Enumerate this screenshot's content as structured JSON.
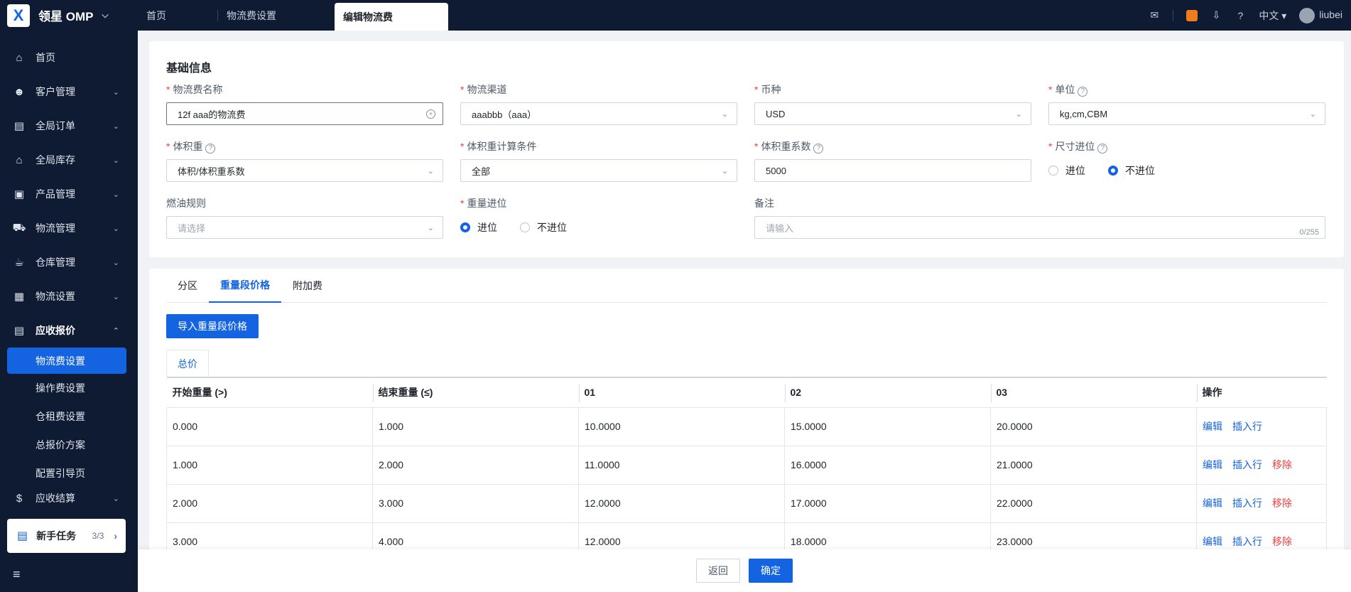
{
  "app": {
    "name": "领星 OMP",
    "logo": "X"
  },
  "tabs": [
    {
      "label": "首页"
    },
    {
      "label": "物流费设置"
    },
    {
      "label": "编辑物流费"
    }
  ],
  "topbar": {
    "lang": "中文",
    "user": "liubei"
  },
  "sidebar": {
    "items": [
      {
        "label": "首页",
        "icon": "home-icon"
      },
      {
        "label": "客户管理",
        "icon": "customer-icon"
      },
      {
        "label": "全局订单",
        "icon": "order-icon"
      },
      {
        "label": "全局库存",
        "icon": "inventory-icon"
      },
      {
        "label": "产品管理",
        "icon": "product-icon"
      },
      {
        "label": "物流管理",
        "icon": "truck-icon"
      },
      {
        "label": "仓库管理",
        "icon": "warehouse-icon"
      },
      {
        "label": "物流设置",
        "icon": "box-icon"
      },
      {
        "label": "应收报价",
        "icon": "quote-icon"
      }
    ],
    "sub_items": [
      {
        "label": "物流费设置"
      },
      {
        "label": "操作费设置"
      },
      {
        "label": "仓租费设置"
      },
      {
        "label": "总报价方案"
      },
      {
        "label": "配置引导页"
      }
    ],
    "partial_item": "应收结算",
    "new_task": {
      "label": "新手任务",
      "count": "3/3"
    }
  },
  "form": {
    "section_title": "基础信息",
    "name": {
      "label": "物流费名称",
      "value": "12f aaa的物流费"
    },
    "channel": {
      "label": "物流渠道",
      "value": "aaabbb（aaa）"
    },
    "currency": {
      "label": "币种",
      "value": "USD"
    },
    "unit": {
      "label": "单位",
      "value": "kg,cm,CBM"
    },
    "vol_weight": {
      "label": "体积重",
      "value": "体积/体积重系数"
    },
    "vol_condition": {
      "label": "体积重计算条件",
      "value": "全部"
    },
    "vol_factor": {
      "label": "体积重系数",
      "value": "5000"
    },
    "size_round": {
      "label": "尺寸进位",
      "options": [
        "进位",
        "不进位"
      ],
      "selected": 1
    },
    "fuel_rule": {
      "label": "燃油规则",
      "placeholder": "请选择"
    },
    "weight_round": {
      "label": "重量进位",
      "options": [
        "进位",
        "不进位"
      ],
      "selected": 0
    },
    "remark": {
      "label": "备注",
      "placeholder": "请输入",
      "count": "0/255"
    }
  },
  "pricing": {
    "tabs": [
      "分区",
      "重量段价格",
      "附加费"
    ],
    "active_tab": 1,
    "import_button": "导入重量段价格",
    "subtab": "总价",
    "headers": [
      "开始重量 (>)",
      "结束重量 (≤)",
      "01",
      "02",
      "03",
      "操作"
    ],
    "rows": [
      {
        "start": "0.000",
        "end": "1.000",
        "z1": "10.0000",
        "z2": "15.0000",
        "z3": "20.0000",
        "ops": [
          "编辑",
          "插入行"
        ]
      },
      {
        "start": "1.000",
        "end": "2.000",
        "z1": "11.0000",
        "z2": "16.0000",
        "z3": "21.0000",
        "ops": [
          "编辑",
          "插入行",
          "移除"
        ]
      },
      {
        "start": "2.000",
        "end": "3.000",
        "z1": "12.0000",
        "z2": "17.0000",
        "z3": "22.0000",
        "ops": [
          "编辑",
          "插入行",
          "移除"
        ]
      },
      {
        "start": "3.000",
        "end": "4.000",
        "z1": "12.0000",
        "z2": "18.0000",
        "z3": "23.0000",
        "ops": [
          "编辑",
          "插入行",
          "移除"
        ]
      }
    ]
  },
  "footer": {
    "back": "返回",
    "confirm": "确定"
  },
  "colors": {
    "primary": "#1463e0",
    "nav_bg": "#0e1b33",
    "danger": "#f53f3f"
  }
}
